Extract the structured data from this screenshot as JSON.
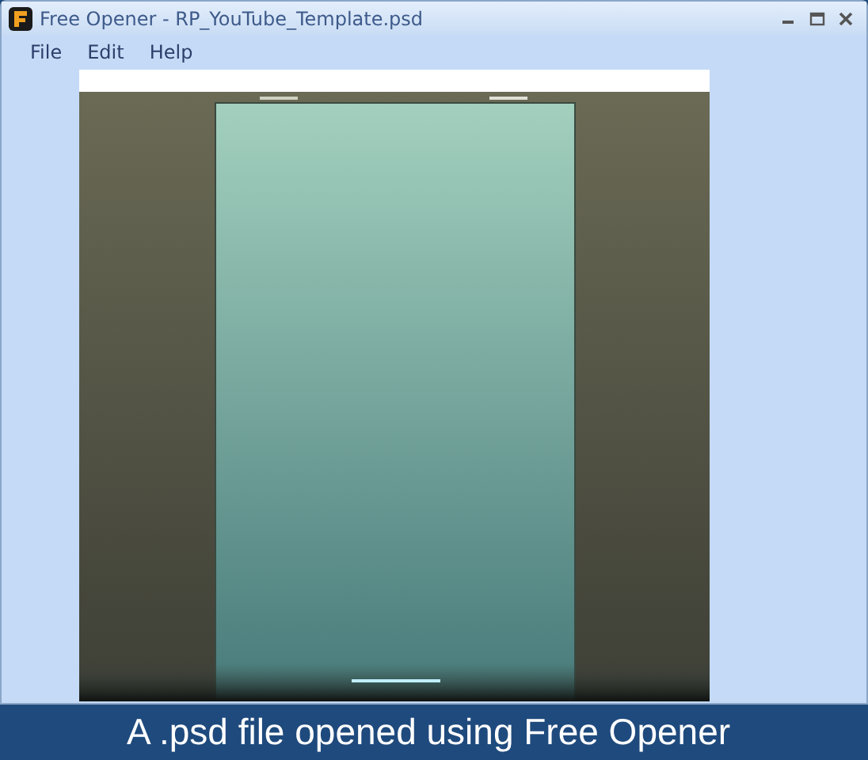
{
  "window": {
    "title": "Free Opener - RP_YouTube_Template.psd"
  },
  "menu": [
    "File",
    "Edit",
    "Help"
  ],
  "caption": "A .psd file opened using Free Opener"
}
